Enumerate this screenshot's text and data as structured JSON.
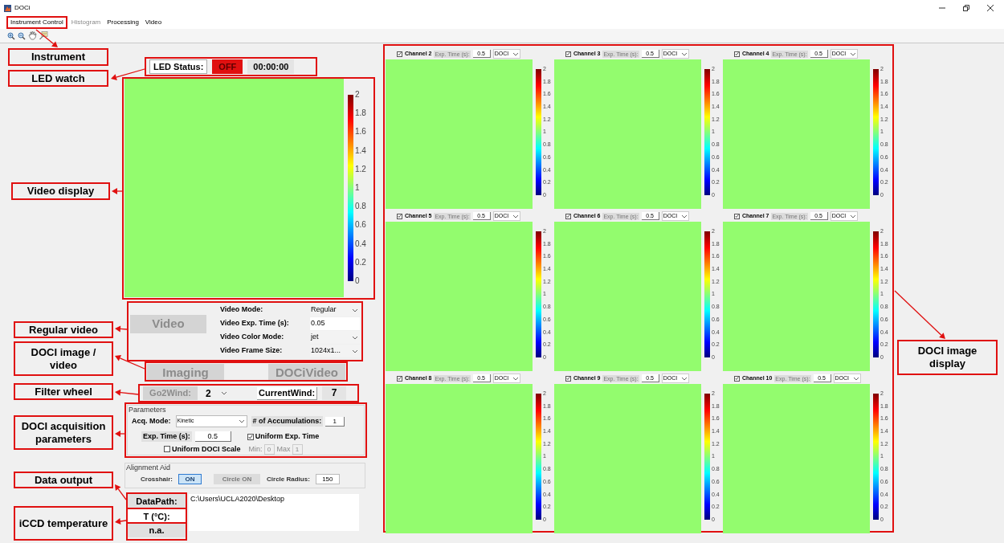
{
  "window": {
    "title": "DOCi"
  },
  "menu": [
    {
      "label": "Instrument Control",
      "disabled": false
    },
    {
      "label": "Histogram",
      "disabled": true
    },
    {
      "label": "Processing",
      "disabled": false
    },
    {
      "label": "Video",
      "disabled": false
    }
  ],
  "led": {
    "label": "LED Status:",
    "state": "OFF",
    "lit": false,
    "timer": "00:00:00"
  },
  "video_display": {
    "colorbar_ticks": [
      "2",
      "1.8",
      "1.6",
      "1.4",
      "1.2",
      "1",
      "0.8",
      "0.6",
      "0.4",
      "0.2",
      "0"
    ]
  },
  "video_controls": {
    "button": {
      "label": "Video",
      "disabled": true
    },
    "fields": [
      {
        "label": "Video Mode:",
        "value": "Regular",
        "kind": "dropdown"
      },
      {
        "label": "Video Exp. Time (s):",
        "value": "0.05",
        "kind": "text"
      },
      {
        "label": "Video Color Mode:",
        "value": "jet",
        "kind": "dropdown"
      },
      {
        "label": "Video Frame Size:",
        "value": "1024x1...",
        "kind": "dropdown"
      }
    ]
  },
  "imaging_buttons": [
    {
      "label": "Imaging",
      "disabled": true
    },
    {
      "label": "DOCiVideo",
      "disabled": true
    }
  ],
  "filter_wheel": {
    "go": {
      "label": "Go2Wind:",
      "disabled": true
    },
    "go_value": "2",
    "current_label": "CurrentWind:",
    "current_value": "7"
  },
  "parameters": {
    "title": "Parameters",
    "acq_mode_label": "Acq. Mode:",
    "acq_mode": "Kinetic",
    "accum_label": "# of Accumulations:",
    "accum": "1",
    "exp_label": "Exp. Time (s):",
    "exp": "0.5",
    "uniform_exp": {
      "label": "Uniform Exp. Time",
      "checked": true
    },
    "uniform_scale": {
      "label": "Uniform DOCI Scale",
      "checked": false
    },
    "min_label": "Min:",
    "min": "0",
    "max_label": "Max",
    "max": "1"
  },
  "alignment": {
    "title": "Alignment Aid",
    "crosshair_label": "Crosshair:",
    "crosshair": {
      "label": "ON",
      "on": true
    },
    "circle": {
      "label": "Circle ON",
      "disabled": true
    },
    "radius_label": "Circle Radius:",
    "radius": "150"
  },
  "data": {
    "path_label": "DataPath:",
    "path": "C:\\Users\\UCLA2020\\Desktop",
    "temp_label": "T (°C):",
    "temp": "n.a."
  },
  "channels": [
    {
      "name": "Channel 2",
      "checked": true,
      "exp_label": {
        "label": "Exp. Time (s):",
        "disabled": true
      },
      "exp": "0.5",
      "mode": "DOCI",
      "colorbar_ticks": [
        "2",
        "1.8",
        "1.6",
        "1.4",
        "1.2",
        "1",
        "0.8",
        "0.6",
        "0.4",
        "0.2",
        "0"
      ]
    },
    {
      "name": "Channel 3",
      "checked": true,
      "exp_label": {
        "label": "Exp. Time (s):",
        "disabled": true
      },
      "exp": "0.5",
      "mode": "DOCI",
      "colorbar_ticks": [
        "2",
        "1.8",
        "1.6",
        "1.4",
        "1.2",
        "1",
        "0.8",
        "0.6",
        "0.4",
        "0.2",
        "0"
      ]
    },
    {
      "name": "Channel 4",
      "checked": true,
      "exp_label": {
        "label": "Exp. Time (s):",
        "disabled": true
      },
      "exp": "0.5",
      "mode": "DOCI",
      "colorbar_ticks": [
        "2",
        "1.8",
        "1.6",
        "1.4",
        "1.2",
        "1",
        "0.8",
        "0.6",
        "0.4",
        "0.2",
        "0"
      ]
    },
    {
      "name": "Channel 5",
      "checked": true,
      "exp_label": {
        "label": "Exp. Time (s):",
        "disabled": true
      },
      "exp": "0.5",
      "mode": "DOCI",
      "colorbar_ticks": [
        "2",
        "1.8",
        "1.6",
        "1.4",
        "1.2",
        "1",
        "0.8",
        "0.6",
        "0.4",
        "0.2",
        "0"
      ]
    },
    {
      "name": "Channel 6",
      "checked": true,
      "exp_label": {
        "label": "Exp. Time (s):",
        "disabled": true
      },
      "exp": "0.5",
      "mode": "DOCI",
      "colorbar_ticks": [
        "2",
        "1.8",
        "1.6",
        "1.4",
        "1.2",
        "1",
        "0.8",
        "0.6",
        "0.4",
        "0.2",
        "0"
      ]
    },
    {
      "name": "Channel 7",
      "checked": true,
      "exp_label": {
        "label": "Exp. Time (s):",
        "disabled": true
      },
      "exp": "0.5",
      "mode": "DOCI",
      "colorbar_ticks": [
        "2",
        "1.8",
        "1.6",
        "1.4",
        "1.2",
        "1",
        "0.8",
        "0.6",
        "0.4",
        "0.2",
        "0"
      ]
    },
    {
      "name": "Channel 8",
      "checked": true,
      "exp_label": {
        "label": "Exp. Time (s):",
        "disabled": true
      },
      "exp": "0.5",
      "mode": "DOCI",
      "colorbar_ticks": [
        "2",
        "1.8",
        "1.6",
        "1.4",
        "1.2",
        "1",
        "0.8",
        "0.6",
        "0.4",
        "0.2",
        "0"
      ]
    },
    {
      "name": "Channel 9",
      "checked": true,
      "exp_label": {
        "label": "Exp. Time (s):",
        "disabled": true
      },
      "exp": "0.5",
      "mode": "DOCI",
      "colorbar_ticks": [
        "2",
        "1.8",
        "1.6",
        "1.4",
        "1.2",
        "1",
        "0.8",
        "0.6",
        "0.4",
        "0.2",
        "0"
      ]
    },
    {
      "name": "Channel 10",
      "checked": true,
      "exp_label": {
        "label": "Exp. Time (s):",
        "disabled": true
      },
      "exp": "0.5",
      "mode": "DOCI",
      "colorbar_ticks": [
        "2",
        "1.8",
        "1.6",
        "1.4",
        "1.2",
        "1",
        "0.8",
        "0.6",
        "0.4",
        "0.2",
        "0"
      ]
    }
  ],
  "annotations": [
    {
      "label": "Instrument"
    },
    {
      "label": "LED watch"
    },
    {
      "label": "Video display"
    },
    {
      "label": "Regular video"
    },
    {
      "label": "DOCI image / video"
    },
    {
      "label": "Filter wheel"
    },
    {
      "label": "DOCI acquisition parameters"
    },
    {
      "label": "Data output"
    },
    {
      "label": "iCCD temperature"
    },
    {
      "label": "DOCI image display"
    }
  ]
}
